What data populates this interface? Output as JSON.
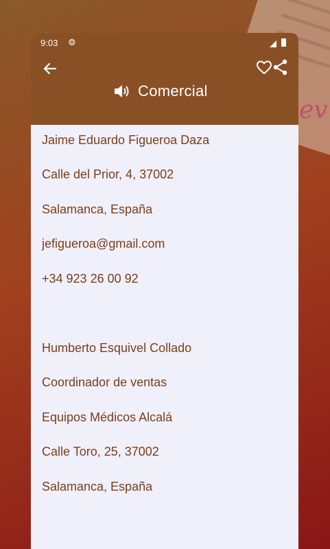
{
  "status_bar": {
    "time": "9:03"
  },
  "header": {
    "title": "Comercial"
  },
  "contacts": [
    {
      "lines": [
        "Jaime Eduardo Figueroa Daza",
        "Calle del Prior, 4, 37002",
        "Salamanca, España",
        "jefigueroa@gmail.com",
        "+34 923 26 00 92"
      ]
    },
    {
      "lines": [
        "Humberto Esquivel Collado",
        "Coordinador de ventas",
        "Equipos Médicos Alcalá",
        "Calle Toro, 25, 37002",
        "Salamanca, España"
      ]
    }
  ],
  "colors": {
    "header": "#8a5025",
    "text": "#7a3e1a",
    "card": "#f0f0fb"
  },
  "icons": [
    "settings-icon",
    "signal-icon",
    "battery-icon",
    "back-arrow-icon",
    "heart-icon",
    "share-icon",
    "speaker-icon"
  ]
}
